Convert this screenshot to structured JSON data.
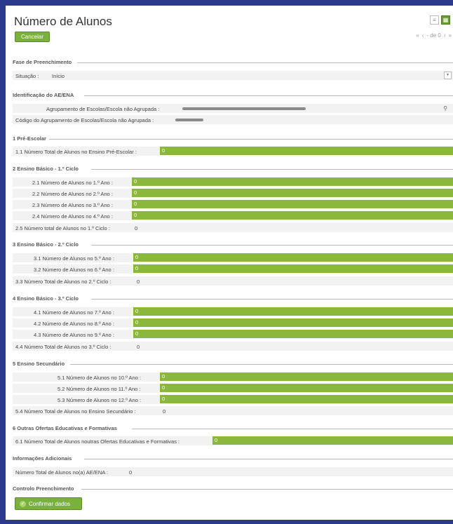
{
  "page": {
    "title": "Número de Alunos",
    "cancel_label": "Cancelar",
    "pager_text": "- de 0"
  },
  "fase": {
    "title": "Fase de Preenchimento",
    "situacao_label": "Situação :",
    "situacao_value": "Início"
  },
  "ident": {
    "title": "Identificação do AE/ENA",
    "agrup_label": "Agrupamento de Escolas/Escola não Agrupada :",
    "codigo_label": "Código do Agrupamento de Escolas/Escola não Agrupada :"
  },
  "s1": {
    "title": "1 Pré-Escolar",
    "r1_label": "1.1 Número Total de Alunos no Ensino Pré-Escolar :",
    "r1_value": "0"
  },
  "s2": {
    "title": "2 Ensino Básico - 1.º Ciclo",
    "r1_label": "2.1 Número de Alunos no 1.º Ano :",
    "r1_value": "0",
    "r2_label": "2.2 Número de Alunos no 2.º Ano :",
    "r2_value": "0",
    "r3_label": "2.3 Número de Alunos no 3.º Ano :",
    "r3_value": "0",
    "r4_label": "2.4 Número de Alunos no 4.º Ano :",
    "r4_value": "0",
    "t_label": "2.5 Número total de Alunos no 1.º Ciclo :",
    "t_value": "0"
  },
  "s3": {
    "title": "3 Ensino Básico - 2.º Ciclo",
    "r1_label": "3.1 Número de Alunos no 5.º Ano :",
    "r1_value": "0",
    "r2_label": "3.2 Número de Alunos no 6.º Ano :",
    "r2_value": "0",
    "t_label": "3.3 Número Total de Alunos no 2.º Ciclo :",
    "t_value": "0"
  },
  "s4": {
    "title": "4 Ensino Básico - 3.º Ciclo",
    "r1_label": "4.1 Número de Alunos no 7.º Ano :",
    "r1_value": "0",
    "r2_label": "4.2 Número de Alunos no 8.º Ano :",
    "r2_value": "0",
    "r3_label": "4.3 Número de Alunos no 9.º Ano :",
    "r3_value": "0",
    "t_label": "4.4 Número Total de Alunos no 3.º Ciclo :",
    "t_value": "0"
  },
  "s5": {
    "title": "5 Ensino Secundário",
    "r1_label": "5.1 Número de Alunos no 10.º Ano :",
    "r1_value": "0",
    "r2_label": "5.2 Número de Alunos no 11.º Ano :",
    "r2_value": "0",
    "r3_label": "5.3 Número de Alunos no 12.º Ano :",
    "r3_value": "0",
    "t_label": "5.4 Número Total de Alunos no Ensino Secundário :",
    "t_value": "0"
  },
  "s6": {
    "title": "6 Outras Ofertas Educativas e Formativas",
    "r1_label": "6.1 Número Total de Alunos noutras Ofertas Educativas e Formativas :",
    "r1_value": "0"
  },
  "info": {
    "title": "Informações Adicionais",
    "t_label": "Número Total de Alunos no(a) AE/ENA :",
    "t_value": "0"
  },
  "ctrl": {
    "title": "Controlo Preenchimento",
    "confirm_label": "Confirmar dados"
  },
  "colors": {
    "accent": "#8bb83c",
    "button": "#7ab03c",
    "frame": "#2b3a8c"
  }
}
